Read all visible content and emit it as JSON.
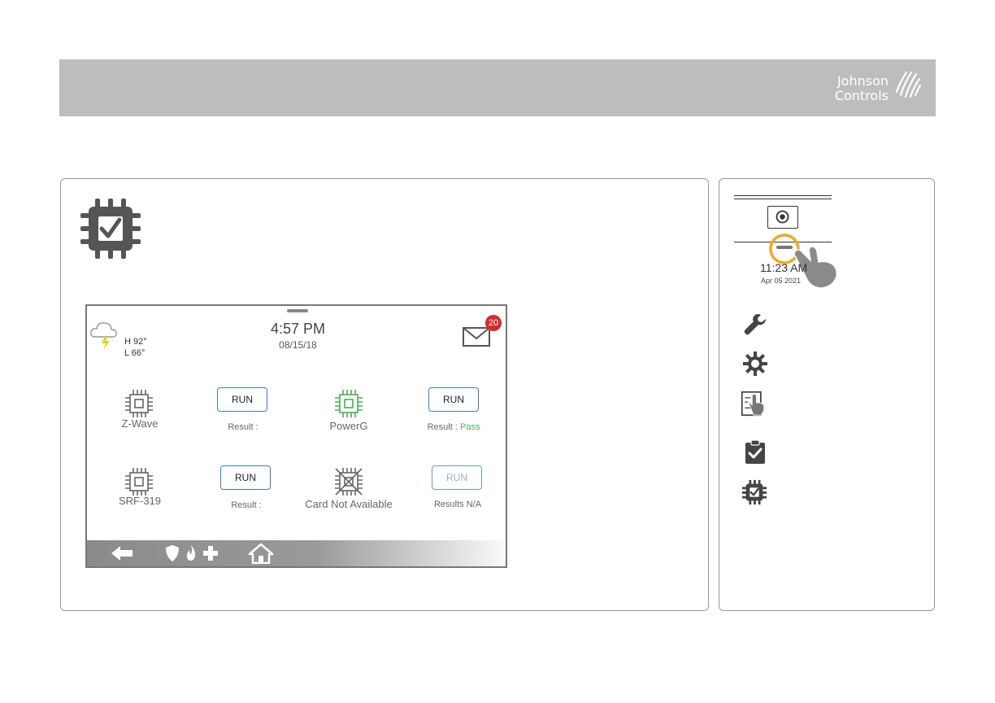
{
  "brand": {
    "line1": "Johnson",
    "line2": "Controls"
  },
  "device": {
    "weather": {
      "high": "H 92°",
      "low": "L 66°",
      "icon": "cloud-lightning-icon"
    },
    "clock": {
      "time": "4:57 PM",
      "date": "08/15/18"
    },
    "messages": {
      "count": "20",
      "icon": "mail-icon"
    },
    "modules": [
      {
        "name": "Z-Wave",
        "button": "RUN",
        "result_label": "Result :",
        "result_value": "",
        "status": "available",
        "chip_color": "#666666"
      },
      {
        "name": "PowerG",
        "button": "RUN",
        "result_label": "Result :",
        "result_value": " Pass",
        "status": "available",
        "chip_color": "#4caf50"
      },
      {
        "name": "SRF-319",
        "button": "RUN",
        "result_label": "Result :",
        "result_value": "",
        "status": "available",
        "chip_color": "#666666"
      },
      {
        "name": "Card Not Available",
        "button": "RUN",
        "result_label": "Results N/A",
        "result_value": "",
        "status": "unavailable",
        "chip_color": "#666666"
      }
    ],
    "bottombar": {
      "icons": [
        "back-arrow-icon",
        "shield-icon",
        "fire-icon",
        "medical-cross-icon",
        "home-icon"
      ]
    }
  },
  "sidebar": {
    "time": "11:23 AM",
    "date": "Apr 05 2021",
    "menu_icons": [
      "wrench-icon",
      "gear-icon",
      "touch-screen-icon",
      "clipboard-check-icon",
      "chip-check-icon"
    ]
  },
  "colors": {
    "banner": "#bdbdbd",
    "accent_orange": "#f5a623",
    "pass_green": "#4caf50",
    "badge_red": "#d62b2b",
    "button_blue": "#3a7bd5"
  }
}
